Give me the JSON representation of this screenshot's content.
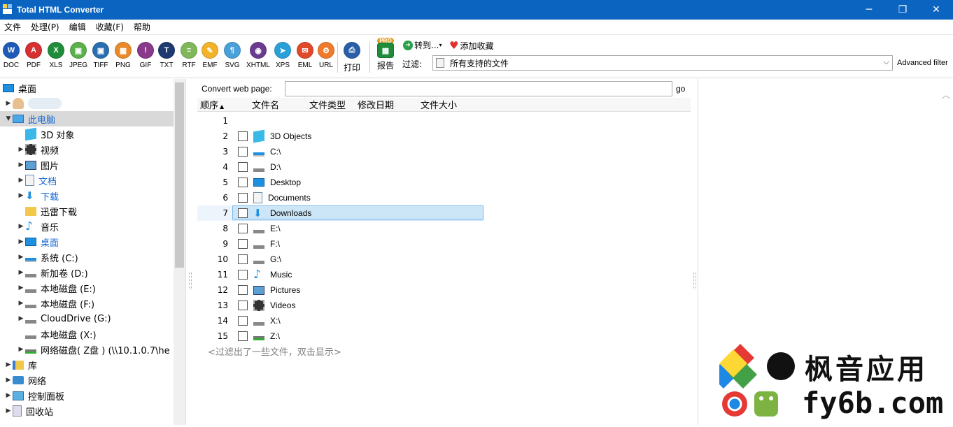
{
  "window": {
    "title": "Total HTML Converter"
  },
  "menu": [
    "文件",
    "处理(P)",
    "编辑",
    "收藏(F)",
    "帮助"
  ],
  "toolbar": {
    "formats": [
      {
        "label": "DOC",
        "icon": "doc-icon",
        "color": "#1e5bb8",
        "glyph": "W"
      },
      {
        "label": "PDF",
        "icon": "pdf-icon",
        "color": "#d63030",
        "glyph": "A"
      },
      {
        "label": "XLS",
        "icon": "xls-icon",
        "color": "#1f8c3a",
        "glyph": "X"
      },
      {
        "label": "JPEG",
        "icon": "jpeg-icon",
        "color": "#5ab04a",
        "glyph": "▣"
      },
      {
        "label": "TIFF",
        "icon": "tiff-icon",
        "color": "#2a6eb0",
        "glyph": "▣"
      },
      {
        "label": "PNG",
        "icon": "png-icon",
        "color": "#e88a2a",
        "glyph": "▦"
      },
      {
        "label": "GIF",
        "icon": "gif-icon",
        "color": "#8a3a8a",
        "glyph": "!"
      },
      {
        "label": "TXT",
        "icon": "txt-icon",
        "color": "#1e3a70",
        "glyph": "T"
      },
      {
        "label": "RTF",
        "icon": "rtf-icon",
        "color": "#7fb85a",
        "glyph": "≡"
      },
      {
        "label": "EMF",
        "icon": "emf-icon",
        "color": "#f2b32a",
        "glyph": "✎"
      },
      {
        "label": "SVG",
        "icon": "svg-icon",
        "color": "#4aa0d8",
        "glyph": "¶"
      },
      {
        "label": "XHTML",
        "icon": "xhtml-icon",
        "color": "#6a3a90",
        "glyph": "◉"
      },
      {
        "label": "XPS",
        "icon": "xps-icon",
        "color": "#2aa0d8",
        "glyph": "➤"
      },
      {
        "label": "EML",
        "icon": "eml-icon",
        "color": "#e04a2a",
        "glyph": "✉"
      },
      {
        "label": "URL",
        "icon": "url-icon",
        "color": "#f07a2a",
        "glyph": "⚙"
      }
    ],
    "print_label": "打印",
    "report_label": "报告",
    "report_badge": "PRO",
    "goto_label": "转到...",
    "add_fav_label": "添加收藏",
    "filter_label": "过滤:",
    "filter_value": "所有支持的文件",
    "advanced_filter": "Advanced filter"
  },
  "tree": [
    {
      "label": "桌面",
      "icon": "desktop-icon",
      "indent": 0,
      "arrow": ""
    },
    {
      "label": "",
      "icon": "user-icon",
      "indent": 1,
      "arrow": "▶"
    },
    {
      "label": "此电脑",
      "icon": "computer-icon",
      "indent": 1,
      "arrow": "▼",
      "selected": true
    },
    {
      "label": "3D 对象",
      "icon": "3d-objects-icon",
      "indent": 2,
      "arrow": ""
    },
    {
      "label": "视频",
      "icon": "video-icon",
      "indent": 2,
      "arrow": "▶"
    },
    {
      "label": "图片",
      "icon": "pictures-icon",
      "indent": 2,
      "arrow": "▶"
    },
    {
      "label": "文档",
      "icon": "documents-icon",
      "indent": 2,
      "arrow": "▶",
      "blue": true
    },
    {
      "label": "下载",
      "icon": "download-icon",
      "indent": 2,
      "arrow": "▶",
      "blue": true
    },
    {
      "label": "迅雷下载",
      "icon": "folder-icon",
      "indent": 2,
      "arrow": ""
    },
    {
      "label": "音乐",
      "icon": "music-icon",
      "indent": 2,
      "arrow": "▶"
    },
    {
      "label": "桌面",
      "icon": "desktop-icon",
      "indent": 2,
      "arrow": "▶",
      "blue": true
    },
    {
      "label": "系统 (C:)",
      "icon": "system-drive-icon",
      "indent": 2,
      "arrow": "▶"
    },
    {
      "label": "新加卷 (D:)",
      "icon": "drive-icon",
      "indent": 2,
      "arrow": "▶"
    },
    {
      "label": "本地磁盘 (E:)",
      "icon": "drive-icon",
      "indent": 2,
      "arrow": "▶"
    },
    {
      "label": "本地磁盘 (F:)",
      "icon": "drive-icon",
      "indent": 2,
      "arrow": "▶"
    },
    {
      "label": "CloudDrive (G:)",
      "icon": "drive-icon",
      "indent": 2,
      "arrow": "▶"
    },
    {
      "label": "本地磁盘 (X:)",
      "icon": "drive-icon",
      "indent": 2,
      "arrow": ""
    },
    {
      "label": "网络磁盘( Z盘 ) (\\\\10.1.0.7\\he",
      "icon": "network-drive-icon",
      "indent": 2,
      "arrow": "▶"
    },
    {
      "label": "库",
      "icon": "library-icon",
      "indent": 1,
      "arrow": "▶"
    },
    {
      "label": "网络",
      "icon": "network-icon",
      "indent": 1,
      "arrow": "▶"
    },
    {
      "label": "控制面板",
      "icon": "control-panel-icon",
      "indent": 1,
      "arrow": "▶"
    },
    {
      "label": "回收站",
      "icon": "recycle-bin-icon",
      "indent": 1,
      "arrow": "▶"
    }
  ],
  "web": {
    "label": "Convert web page:",
    "value": "",
    "go": "go"
  },
  "columns": [
    "顺序",
    "文件名",
    "文件类型",
    "修改日期",
    "文件大小"
  ],
  "files": [
    {
      "n": "1",
      "name": "",
      "icon": ""
    },
    {
      "n": "2",
      "name": "3D Objects",
      "icon": "3d-objects-icon"
    },
    {
      "n": "3",
      "name": "C:\\",
      "icon": "system-drive-icon"
    },
    {
      "n": "4",
      "name": "D:\\",
      "icon": "drive-icon"
    },
    {
      "n": "5",
      "name": "Desktop",
      "icon": "desktop-icon"
    },
    {
      "n": "6",
      "name": "Documents",
      "icon": "documents-icon"
    },
    {
      "n": "7",
      "name": "Downloads",
      "icon": "download-icon",
      "selected": true
    },
    {
      "n": "8",
      "name": "E:\\",
      "icon": "drive-icon"
    },
    {
      "n": "9",
      "name": "F:\\",
      "icon": "drive-icon"
    },
    {
      "n": "10",
      "name": "G:\\",
      "icon": "drive-icon"
    },
    {
      "n": "11",
      "name": "Music",
      "icon": "music-icon"
    },
    {
      "n": "12",
      "name": "Pictures",
      "icon": "pictures-icon"
    },
    {
      "n": "13",
      "name": "Videos",
      "icon": "video-icon"
    },
    {
      "n": "14",
      "name": "X:\\",
      "icon": "drive-icon"
    },
    {
      "n": "15",
      "name": "Z:\\",
      "icon": "network-drive-icon"
    }
  ],
  "filtered_note": "<过滤出了一些文件，双击显示>",
  "watermark": {
    "text1": "枫音应用",
    "text2": "fy6b.com"
  }
}
